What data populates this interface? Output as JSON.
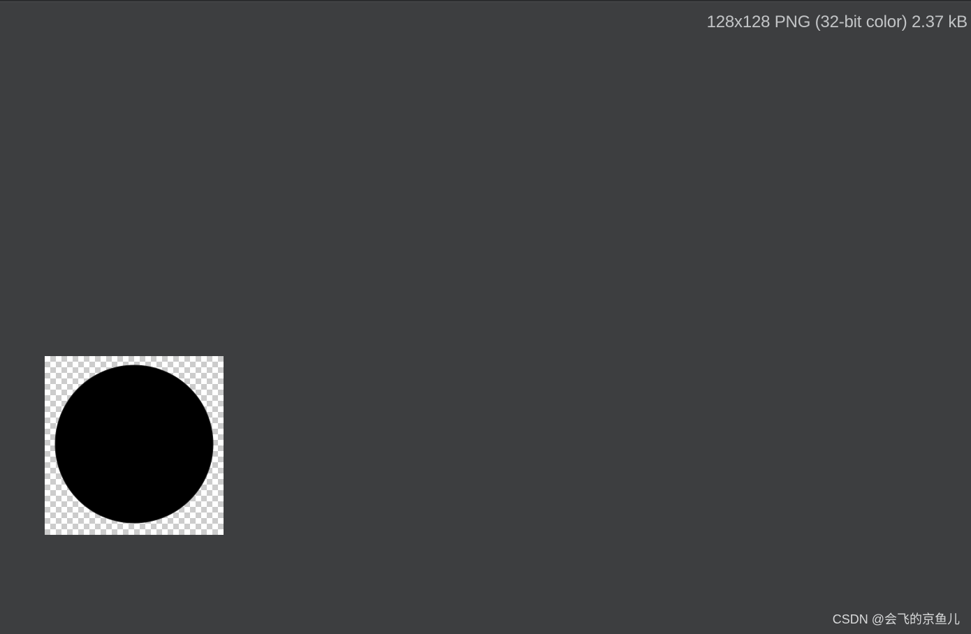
{
  "viewer": {
    "image_info": "128x128 PNG (32-bit color) 2.37 kB",
    "background_color": "#3d3e40"
  },
  "preview": {
    "shape": "circle",
    "fill_color": "#000000",
    "transparency_pattern": "checkerboard"
  },
  "watermark": {
    "text": "CSDN @会飞的京鱼儿"
  }
}
